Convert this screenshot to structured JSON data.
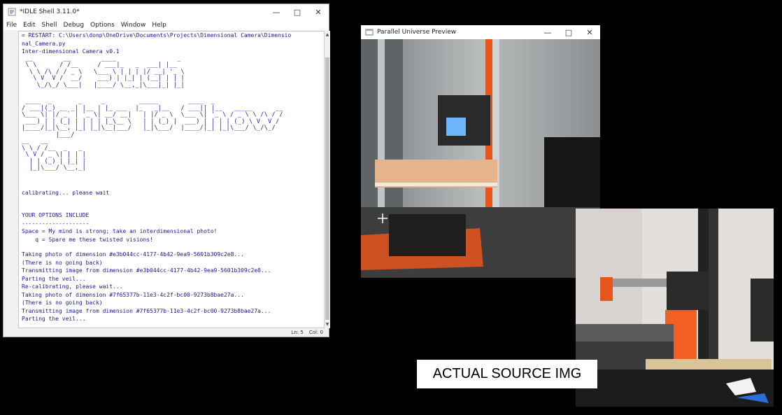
{
  "idle": {
    "title": "*IDLE Shell 3.11.0*",
    "menu": [
      "File",
      "Edit",
      "Shell",
      "Debug",
      "Options",
      "Window",
      "Help"
    ],
    "lines": {
      "restart": "= RESTART: C:\\Users\\donp\\OneDrive\\Documents\\Projects\\Dimensional Camera\\Dimensio",
      "restart2": "nal_Camera.py",
      "version": "Inter-dimensional Camera v0.1",
      "ascii1": " __        __        ____                _     \n \\ \\      / /__     / ___|_   _  ___| |__  \n  \\ \\ /\\ / / _ \\   \\___ \\ | | | |/ __| '_ \\ \n   \\ V  V /  __/    ___) | |_| | (__| | | |\n    \\_/\\_/ \\___|   |____/ \\__,_|\\___|_| |_|",
      "ascii2": " ____  _       _     _         _____        ____  _                   \n/ ___|(_) __ _| |__ | |_ ___  |_   _|__   / ___|| |__   _____      __\n\\___ \\| |/ _` | '_ \\| __/ __|   | |/ _ \\  \\___ \\| '_ \\ / _ \\ \\ /\\ / /\n ___) | | (_| | | | | |_\\__ \\   | | (_) |  ___) | | | | (_) \\ V  V / \n|____/|_|\\__, |_| |_|\\__|___/   |_|\\___/  |____/|_| |_|\\___/ \\_/\\_/  \n         |___/",
      "ascii3": "__   __          \n\\ \\ / /__  _   _ \n \\ V / _ \\| | | |\n  | | (_) | |_| |\n  |_|\\___/ \\__,_|",
      "calibrating": "calibrating... please wait",
      "options_header": "YOUR OPTIONS INCLUDE",
      "rule": "--------------------",
      "space_opt": "Space = My mind is strong; take an interdimensional photo!",
      "q_opt": "    q = Spare me these twisted visions!",
      "taking1": "Taking photo of dimension #e3b044cc-4177-4b42-9ea9-5601b309c2e8...",
      "noback1": "(There is no going back)",
      "transmit1": "Transmitting image from dimension #e3b044cc-4177-4b42-9ea9-5601b309c2e8...",
      "veil1": "Parting the veil...",
      "recal": "Re-calibrating, please wait...",
      "taking2": "Taking photo of dimension #7f65377b-11e3-4c2f-bc00-9273b8bae27a...",
      "noback2": "(There is no going back)",
      "transmit2": "Transmitting image from dimension #7f65377b-11e3-4c2f-bc00-9273b8bae27a...",
      "veil2": "Parting the veil..."
    },
    "status": {
      "ln": "Ln: 5",
      "col": "Col: 0"
    }
  },
  "preview": {
    "title": "Parallel Universe Preview"
  },
  "source_label": "ACTUAL SOURCE IMG",
  "colors": {
    "accent_orange": "#e8551c",
    "code_blue": "#1a1a8a"
  }
}
